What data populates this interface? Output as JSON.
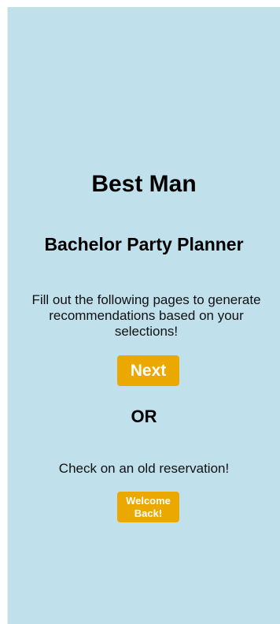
{
  "header": {
    "title": "Best Man",
    "subtitle": "Bachelor Party Planner"
  },
  "main": {
    "instructions": "Fill out the following pages to generate recommendations based on your selections!",
    "next_label": "Next",
    "divider_text": "OR",
    "old_reservation_text": "Check on an old reservation!",
    "welcome_back_label": "Welcome\nBack!"
  },
  "colors": {
    "background": "#c0e0ec",
    "button": "#eba800",
    "button_text": "#ffffff"
  }
}
